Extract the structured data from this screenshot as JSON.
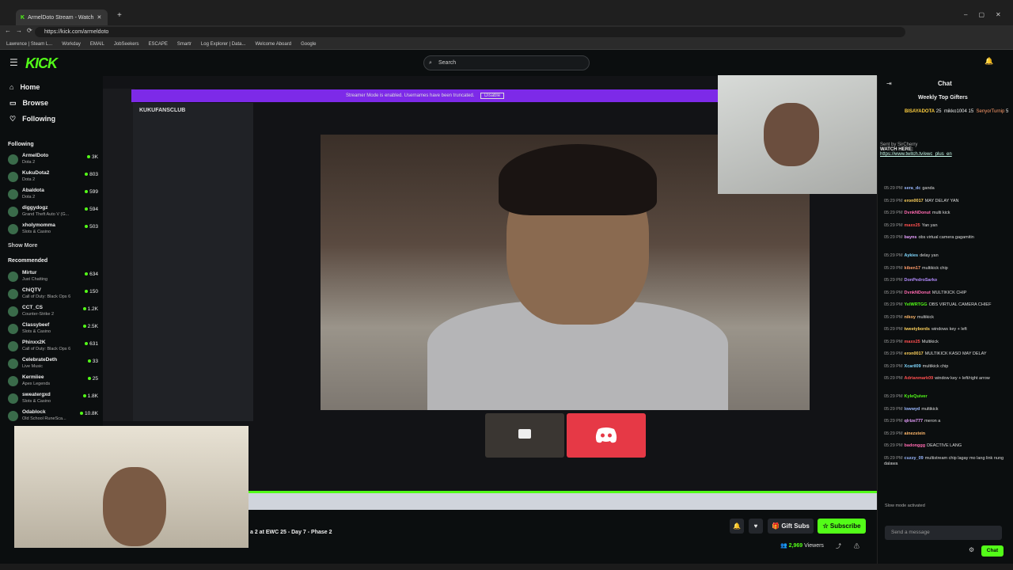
{
  "browser": {
    "tab_title": "ArmelDoto Stream - Watch",
    "url": "https://kick.com/armeldoto",
    "bookmarks": [
      "Lawrence | Steam L...",
      "Workday",
      "EMAIL",
      "JobSeekers",
      "ESCAPE",
      "Smartr",
      "Log Explorer | Data...",
      "Welcome Aboard",
      "Google"
    ]
  },
  "header": {
    "logo": "KICK",
    "search_placeholder": "Search"
  },
  "sidebar": {
    "nav": [
      {
        "label": "Home"
      },
      {
        "label": "Browse"
      },
      {
        "label": "Following"
      }
    ],
    "following_title": "Following",
    "following": [
      {
        "name": "ArmelDoto",
        "category": "Dota 2",
        "viewers": "3K"
      },
      {
        "name": "KukuDota2",
        "category": "Dota 2",
        "viewers": "803"
      },
      {
        "name": "Abaldota",
        "category": "Dota 2",
        "viewers": "599"
      },
      {
        "name": "diggydogz",
        "category": "Grand Theft Auto V (G...",
        "viewers": "594"
      },
      {
        "name": "xholymomma",
        "category": "Slots & Casino",
        "viewers": "503"
      }
    ],
    "show_more": "Show More",
    "recommended_title": "Recommended",
    "recommended": [
      {
        "name": "Mirtur",
        "category": "Just Chatting",
        "viewers": "634"
      },
      {
        "name": "ChiQTV",
        "category": "Call of Duty: Black Ops 6",
        "viewers": "150"
      },
      {
        "name": "CCT_CS",
        "category": "Counter-Strike 2",
        "viewers": "1.2K"
      },
      {
        "name": "Classybeef",
        "category": "Slots & Casino",
        "viewers": "2.5K"
      },
      {
        "name": "Phinxx2K",
        "category": "Call of Duty: Black Ops 6",
        "viewers": "631"
      },
      {
        "name": "CelebrateDeth",
        "category": "Live Music",
        "viewers": "33"
      },
      {
        "name": "Kermiiee",
        "category": "Apex Legends",
        "viewers": "25"
      },
      {
        "name": "sweatergxd",
        "category": "Slots & Casino",
        "viewers": "1.8K"
      },
      {
        "name": "Odablock",
        "category": "Old School RuneSca...",
        "viewers": "10.8K"
      }
    ]
  },
  "stream": {
    "streamer_mode_text": "Streamer Mode is enabled. Usernames have been truncated.",
    "disable_label": "Disable",
    "server_name": "KUKUFANSCLUB",
    "title": "a 2 at EWC 25 - Day 7 - Phase 2",
    "viewers_count": "2,969",
    "viewers_label": "Viewers",
    "gift_label": "Gift Subs",
    "subscribe_label": "Subscribe"
  },
  "chat": {
    "title": "Chat",
    "weekly_title": "Weekly Top Gifters",
    "top_gifters": [
      {
        "name": "BISAYADOTA",
        "count": "25"
      },
      {
        "name": "mikko1004",
        "count": "15"
      },
      {
        "name": "SenyorTurnip",
        "count": "5"
      }
    ],
    "pinned_by": "Sent by SirCherry",
    "pinned_text": "WATCH HERE:",
    "pinned_link": "https://www.twitch.tv/ewc_plus_en",
    "messages": [
      {
        "t": "05:29 PM",
        "u": "sera_dc",
        "m": "ganda",
        "c": "#9ab8ff"
      },
      {
        "t": "05:29 PM",
        "u": "eron0017",
        "m": "MAY DELAY YAN",
        "c": "#ffd35c"
      },
      {
        "t": "05:29 PM",
        "u": "DvnkNDonut",
        "m": "multi kick",
        "c": "#ff6ab0"
      },
      {
        "t": "05:29 PM",
        "u": "maxx25",
        "m": "Yan yan",
        "c": "#ff4f4f"
      },
      {
        "t": "05:29 PM",
        "u": "bayns",
        "m": "obs virtual camera gagamitin",
        "c": "#e8a0ff"
      },
      {
        "t": "05:29 PM",
        "u": "Aykies",
        "m": "delay yan",
        "c": "#80d8ff"
      },
      {
        "t": "05:29 PM",
        "u": "kiben17",
        "m": "multikick chip",
        "c": "#ff9c6b"
      },
      {
        "t": "05:29 PM",
        "u": "DonPedroSarko",
        "m": "",
        "c": "#b48cff"
      },
      {
        "t": "05:29 PM",
        "u": "DvnkNDonut",
        "m": "MULTIKICK CHIP",
        "c": "#ff6ab0"
      },
      {
        "t": "05:29 PM",
        "u": "YelWRTGG",
        "m": "OBS VIRTUAL CAMERA CHIEF",
        "c": "#53fc18"
      },
      {
        "t": "05:29 PM",
        "u": "nikoy",
        "m": "multikick",
        "c": "#ffb86b"
      },
      {
        "t": "05:29 PM",
        "u": "tweetybords",
        "m": "windows key + left",
        "c": "#ffd35c"
      },
      {
        "t": "05:29 PM",
        "u": "maxx25",
        "m": "Multikick",
        "c": "#ff4f4f"
      },
      {
        "t": "05:29 PM",
        "u": "eron0017",
        "m": "MULTIKICK KASO MAY DELAY",
        "c": "#ffd35c"
      },
      {
        "t": "05:29 PM",
        "u": "Xcaril09",
        "m": "multikick chip",
        "c": "#80d8ff"
      },
      {
        "t": "05:29 PM",
        "u": "Adrianmark09",
        "m": "window key + left/right arrow",
        "c": "#ff4f4f"
      },
      {
        "t": "05:29 PM",
        "u": "KyleQuiver",
        "m": "",
        "c": "#53fc18"
      },
      {
        "t": "05:29 PM",
        "u": "lowwyd",
        "m": "multikick",
        "c": "#9ab8ff"
      },
      {
        "t": "05:29 PM",
        "u": "qlrize777",
        "m": "meron a",
        "c": "#e8a0ff"
      },
      {
        "t": "05:29 PM",
        "u": "ainezstein",
        "m": "",
        "c": "#ffb86b"
      },
      {
        "t": "05:29 PM",
        "u": "badonggg",
        "m": "DEACTIVE LANG",
        "c": "#ff6ab0"
      },
      {
        "t": "05:29 PM",
        "u": "cuzzy_09",
        "m": "multistream chip lagay mo lang link nung dalawa",
        "c": "#9ab8ff"
      }
    ],
    "slow_mode": "Slow mode activated",
    "input_placeholder": "Send a message",
    "chat_button": "Chat"
  }
}
